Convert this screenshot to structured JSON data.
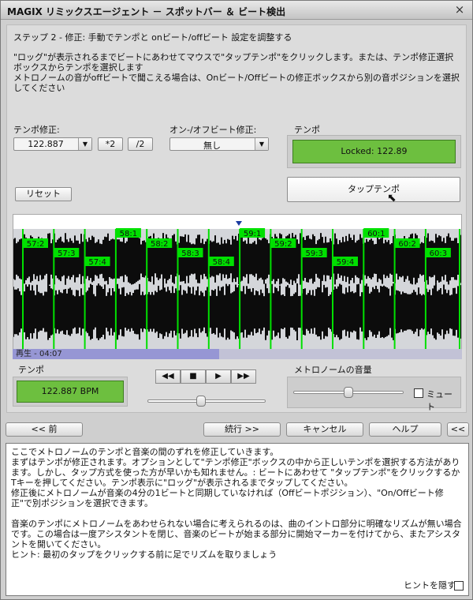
{
  "window": {
    "title": "MAGIX リミックスエージェント － スポットバー ＆ ビート検出",
    "close_icon": "close-icon"
  },
  "step": "ステップ 2 - 修正: 手動でテンポと onビート/offビート 設定を調整する",
  "instructions": [
    "\"ロッグ\"が表示されるまでビートにあわせてマウスで\"タップテンポ\"をクリックします。または、テンポ修正選択ボックスからテンポを選択します",
    "メトロノームの音がoffビートで聞こえる場合は、Onビート/Offビートの修正ボックスから別の音ポジションを選択してください"
  ],
  "tempo_correction": {
    "label": "テンポ修正:",
    "value": "122.887",
    "mult_label": "*2",
    "div_label": "/2"
  },
  "onoff_correction": {
    "label": "オン-/オフビート修正:",
    "value": "無し"
  },
  "tempo_top": {
    "label": "テンポ",
    "value": "Locked: 122.89"
  },
  "reset_label": "リセット",
  "tap_tempo_label": "タップテンポ",
  "waveform": {
    "markers": [
      "57:2",
      "57:3",
      "57:4",
      "58:1",
      "58:2",
      "58:3",
      "58:4",
      "59:1",
      "59:2",
      "59:3",
      "59:4",
      "60:1",
      "60:2",
      "60:3"
    ],
    "marker_color": "#00e000",
    "playback_label": "再生 - 04:07",
    "playback_progress": 0.46
  },
  "tempo_bottom": {
    "label": "テンポ",
    "value": "122.887 BPM"
  },
  "transport": {
    "rewind_icon": "rewind-icon",
    "stop_icon": "stop-icon",
    "play_icon": "play-icon",
    "forward_icon": "fast-forward-icon"
  },
  "position_slider": 0.45,
  "metronome": {
    "label": "メトロノームの音量",
    "mute_label": "ミュート",
    "volume": 0.5
  },
  "nav": {
    "back": "<< 前",
    "continue": "続行 >>",
    "cancel": "キャンセル",
    "help": "ヘルプ",
    "collapse": "<<"
  },
  "help_text": [
    "ここでメトロノームのテンポと音楽の間のずれを修正していきます。",
    "まずはテンポが修正されます。オプションとして\"テンポ修正\"ボックスの中から正しいテンポを選択する方法があります。しかし、タップ方式を使った方が早いかも知れません。: ビートにあわせて \"タップテンポ\"をクリックするかTキーを押してください。テンポ表示に\"ロッグ\"が表示されるまでタップしてください。",
    "修正後にメトロノームが音楽の4分の1ビートと同期していなければ（Offビートポジション）、\"On/Offビート修正\"で別ポジションを選択できます。",
    "",
    "音楽のテンポにメトロノームをあわせられない場合に考えられるのは、曲のイントロ部分に明確なリズムが無い場合です。この場合は一度アシスタントを閉じ、音楽のビートが始まる部分に開始マーカーを付けてから、またアシスタントを開いてください。",
    "ヒント: 最初のタップをクリックする前に足でリズムを取りましょう"
  ],
  "hide_hint_label": "ヒントを隠す"
}
